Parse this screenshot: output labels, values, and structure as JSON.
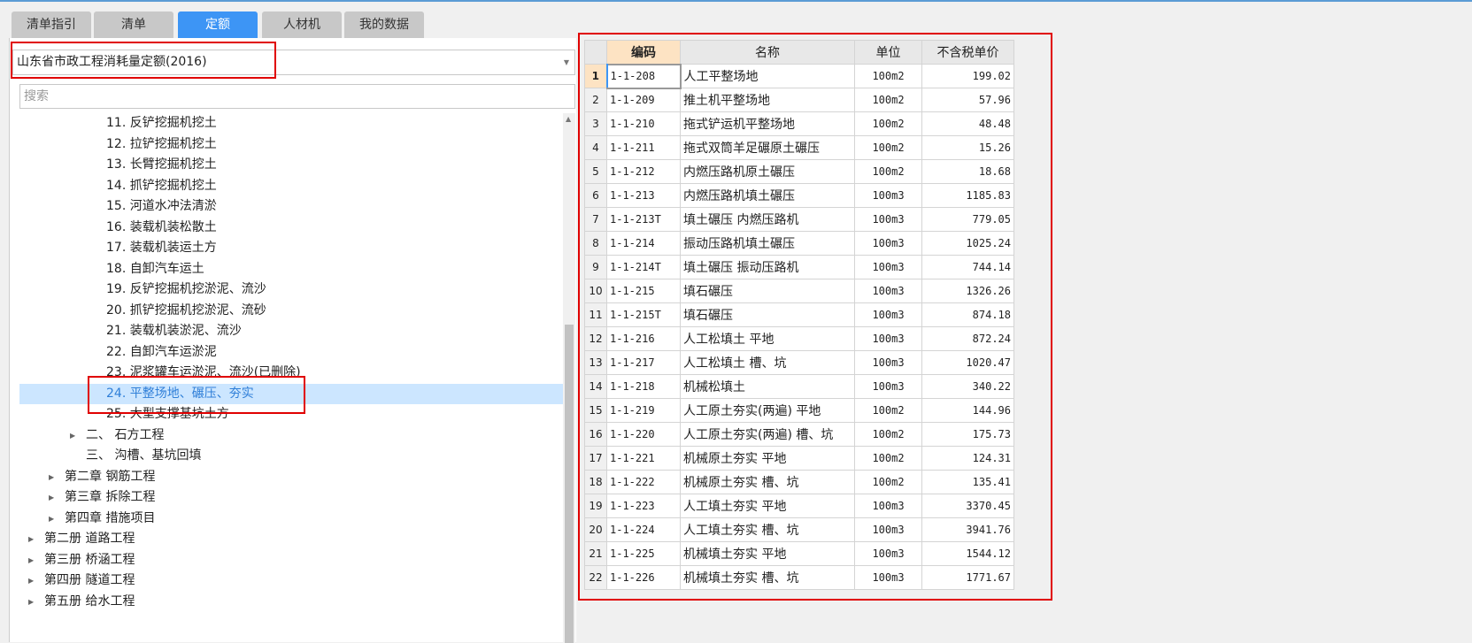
{
  "tabs": [
    "清单指引",
    "清单",
    "定额",
    "人材机",
    "我的数据"
  ],
  "active_tab": 2,
  "dropdown": {
    "value": "山东省市政工程消耗量定额(2016)"
  },
  "search": {
    "placeholder": "搜索"
  },
  "tree": [
    {
      "label": "11. 反铲挖掘机挖土",
      "level": 3
    },
    {
      "label": "12. 拉铲挖掘机挖土",
      "level": 3
    },
    {
      "label": "13. 长臂挖掘机挖土",
      "level": 3
    },
    {
      "label": "14. 抓铲挖掘机挖土",
      "level": 3
    },
    {
      "label": "15. 河道水冲法清淤",
      "level": 3
    },
    {
      "label": "16. 装载机装松散土",
      "level": 3
    },
    {
      "label": "17. 装载机装运土方",
      "level": 3
    },
    {
      "label": "18. 自卸汽车运土",
      "level": 3
    },
    {
      "label": "19. 反铲挖掘机挖淤泥、流沙",
      "level": 3
    },
    {
      "label": "20. 抓铲挖掘机挖淤泥、流砂",
      "level": 3
    },
    {
      "label": "21. 装载机装淤泥、流沙",
      "level": 3
    },
    {
      "label": "22. 自卸汽车运淤泥",
      "level": 3
    },
    {
      "label": "23. 泥浆罐车运淤泥、流沙(已删除)",
      "level": 3
    },
    {
      "label": "24. 平整场地、碾压、夯实",
      "level": 3,
      "selected": true
    },
    {
      "label": "25. 大型支撑基坑土方",
      "level": 3
    },
    {
      "label": "二、 石方工程",
      "level": 2,
      "expandable": true
    },
    {
      "label": "三、 沟槽、基坑回填",
      "level": 2
    },
    {
      "label": "第二章 钢筋工程",
      "level": 1,
      "expandable": true
    },
    {
      "label": "第三章 拆除工程",
      "level": 1,
      "expandable": true
    },
    {
      "label": "第四章 措施项目",
      "level": 1,
      "expandable": true
    },
    {
      "label": "第二册 道路工程",
      "level": 0,
      "expandable": true
    },
    {
      "label": "第三册 桥涵工程",
      "level": 0,
      "expandable": true
    },
    {
      "label": "第四册 隧道工程",
      "level": 0,
      "expandable": true
    },
    {
      "label": "第五册 给水工程",
      "level": 0,
      "expandable": true
    }
  ],
  "table": {
    "headers": [
      "",
      "编码",
      "名称",
      "单位",
      "不含税单价"
    ],
    "rows": [
      [
        "1",
        "1-1-208",
        "人工平整场地",
        "100m2",
        "199.02"
      ],
      [
        "2",
        "1-1-209",
        "推土机平整场地",
        "100m2",
        "57.96"
      ],
      [
        "3",
        "1-1-210",
        "拖式铲运机平整场地",
        "100m2",
        "48.48"
      ],
      [
        "4",
        "1-1-211",
        "拖式双筒羊足碾原土碾压",
        "100m2",
        "15.26"
      ],
      [
        "5",
        "1-1-212",
        "内燃压路机原土碾压",
        "100m2",
        "18.68"
      ],
      [
        "6",
        "1-1-213",
        "内燃压路机填土碾压",
        "100m3",
        "1185.83"
      ],
      [
        "7",
        "1-1-213T",
        "填土碾压 内燃压路机",
        "100m3",
        "779.05"
      ],
      [
        "8",
        "1-1-214",
        "振动压路机填土碾压",
        "100m3",
        "1025.24"
      ],
      [
        "9",
        "1-1-214T",
        "填土碾压 振动压路机",
        "100m3",
        "744.14"
      ],
      [
        "10",
        "1-1-215",
        "填石碾压",
        "100m3",
        "1326.26"
      ],
      [
        "11",
        "1-1-215T",
        "填石碾压",
        "100m3",
        "874.18"
      ],
      [
        "12",
        "1-1-216",
        "人工松填土 平地",
        "100m3",
        "872.24"
      ],
      [
        "13",
        "1-1-217",
        "人工松填土 槽、坑",
        "100m3",
        "1020.47"
      ],
      [
        "14",
        "1-1-218",
        "机械松填土",
        "100m3",
        "340.22"
      ],
      [
        "15",
        "1-1-219",
        "人工原土夯实(两遍) 平地",
        "100m2",
        "144.96"
      ],
      [
        "16",
        "1-1-220",
        "人工原土夯实(两遍) 槽、坑",
        "100m2",
        "175.73"
      ],
      [
        "17",
        "1-1-221",
        "机械原土夯实 平地",
        "100m2",
        "124.31"
      ],
      [
        "18",
        "1-1-222",
        "机械原土夯实 槽、坑",
        "100m2",
        "135.41"
      ],
      [
        "19",
        "1-1-223",
        "人工填土夯实 平地",
        "100m3",
        "3370.45"
      ],
      [
        "20",
        "1-1-224",
        "人工填土夯实 槽、坑",
        "100m3",
        "3941.76"
      ],
      [
        "21",
        "1-1-225",
        "机械填土夯实 平地",
        "100m3",
        "1544.12"
      ],
      [
        "22",
        "1-1-226",
        "机械填土夯实 槽、坑",
        "100m3",
        "1771.67"
      ]
    ]
  }
}
